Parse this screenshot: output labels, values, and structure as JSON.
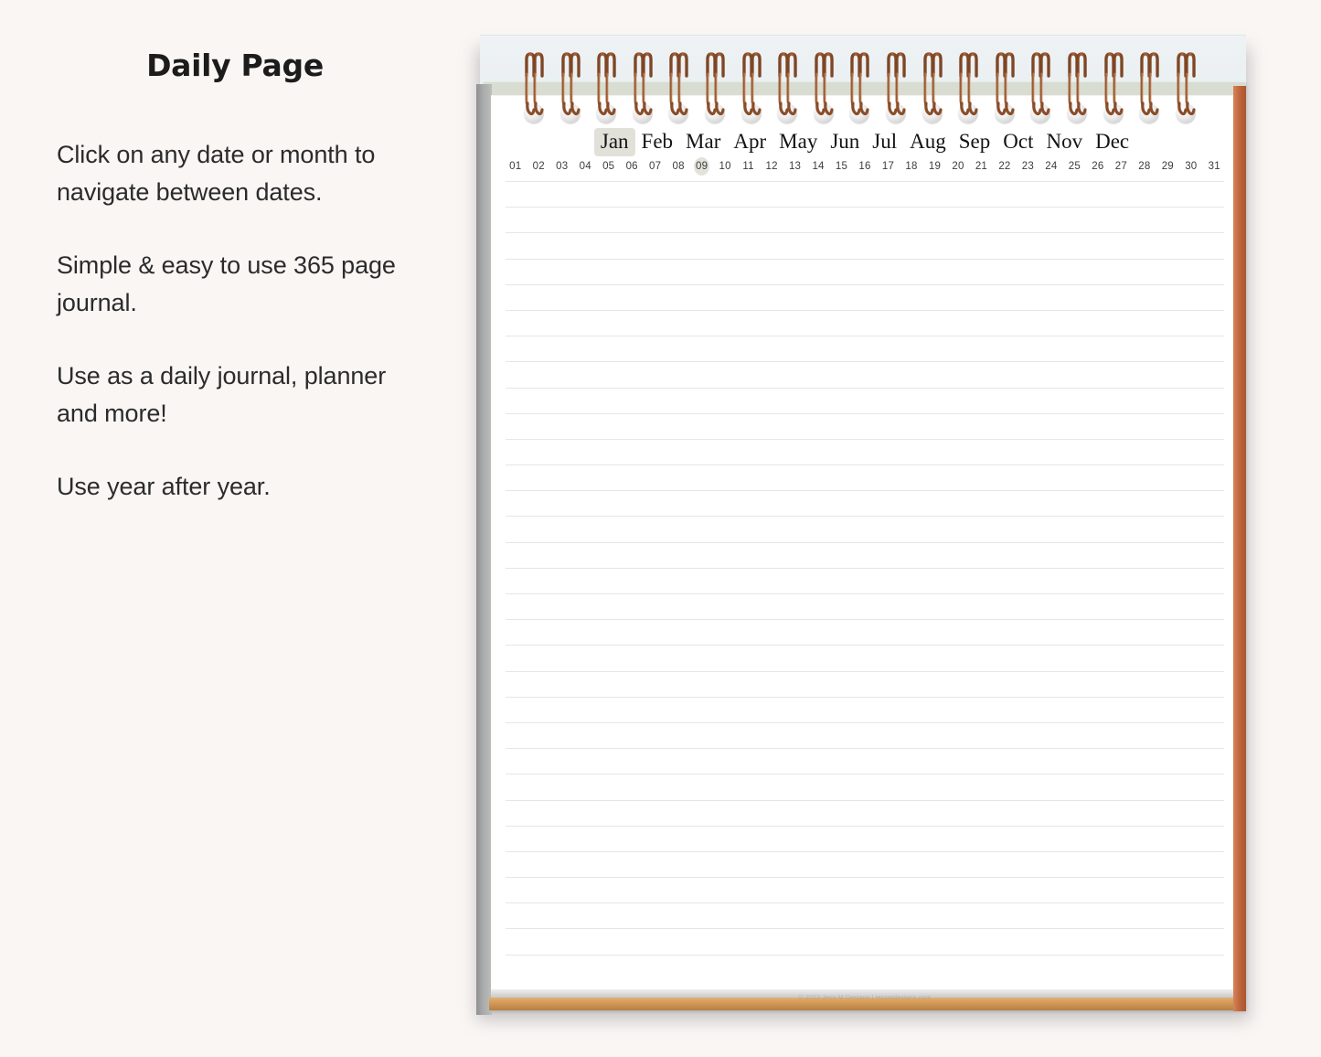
{
  "background_color": "#faf6f4",
  "left_panel": {
    "title": "Daily Page",
    "paragraphs": [
      "Click on any date or month to navigate between dates.",
      "Simple & easy to use 365 page journal.",
      "Use as a daily journal, planner and more!",
      "Use year after year."
    ]
  },
  "notepad": {
    "binding": {
      "icon": "spiral-ring-icon",
      "ring_count": 19,
      "ring_color": "#c07a4e",
      "hole_color": "#e8e8e8"
    },
    "board_color": "#d3d7ca",
    "right_edge_color": "#c0663c",
    "bottom_edge_color": "#d39a58",
    "page_color": "#ffffff",
    "rule_line_color": "#e6e6e6",
    "rule_line_count": 31,
    "months": [
      {
        "label": "Jan",
        "active": true
      },
      {
        "label": "Feb",
        "active": false
      },
      {
        "label": "Mar",
        "active": false
      },
      {
        "label": "Apr",
        "active": false
      },
      {
        "label": "May",
        "active": false
      },
      {
        "label": "Jun",
        "active": false
      },
      {
        "label": "Jul",
        "active": false
      },
      {
        "label": "Aug",
        "active": false
      },
      {
        "label": "Sep",
        "active": false
      },
      {
        "label": "Oct",
        "active": false
      },
      {
        "label": "Nov",
        "active": false
      },
      {
        "label": "Dec",
        "active": false
      }
    ],
    "selected_month": "Jan",
    "days": [
      {
        "label": "01",
        "active": false
      },
      {
        "label": "02",
        "active": false
      },
      {
        "label": "03",
        "active": false
      },
      {
        "label": "04",
        "active": false
      },
      {
        "label": "05",
        "active": false
      },
      {
        "label": "06",
        "active": false
      },
      {
        "label": "07",
        "active": false
      },
      {
        "label": "08",
        "active": false
      },
      {
        "label": "09",
        "active": true
      },
      {
        "label": "10",
        "active": false
      },
      {
        "label": "11",
        "active": false
      },
      {
        "label": "12",
        "active": false
      },
      {
        "label": "13",
        "active": false
      },
      {
        "label": "14",
        "active": false
      },
      {
        "label": "15",
        "active": false
      },
      {
        "label": "16",
        "active": false
      },
      {
        "label": "17",
        "active": false
      },
      {
        "label": "18",
        "active": false
      },
      {
        "label": "19",
        "active": false
      },
      {
        "label": "20",
        "active": false
      },
      {
        "label": "21",
        "active": false
      },
      {
        "label": "22",
        "active": false
      },
      {
        "label": "23",
        "active": false
      },
      {
        "label": "24",
        "active": false
      },
      {
        "label": "25",
        "active": false
      },
      {
        "label": "26",
        "active": false
      },
      {
        "label": "27",
        "active": false
      },
      {
        "label": "28",
        "active": false
      },
      {
        "label": "29",
        "active": false
      },
      {
        "label": "30",
        "active": false
      },
      {
        "label": "31",
        "active": false
      }
    ],
    "selected_day": "09",
    "footer_watermark": "© 2023 Jess M Designs | jessmdesigns.com"
  }
}
